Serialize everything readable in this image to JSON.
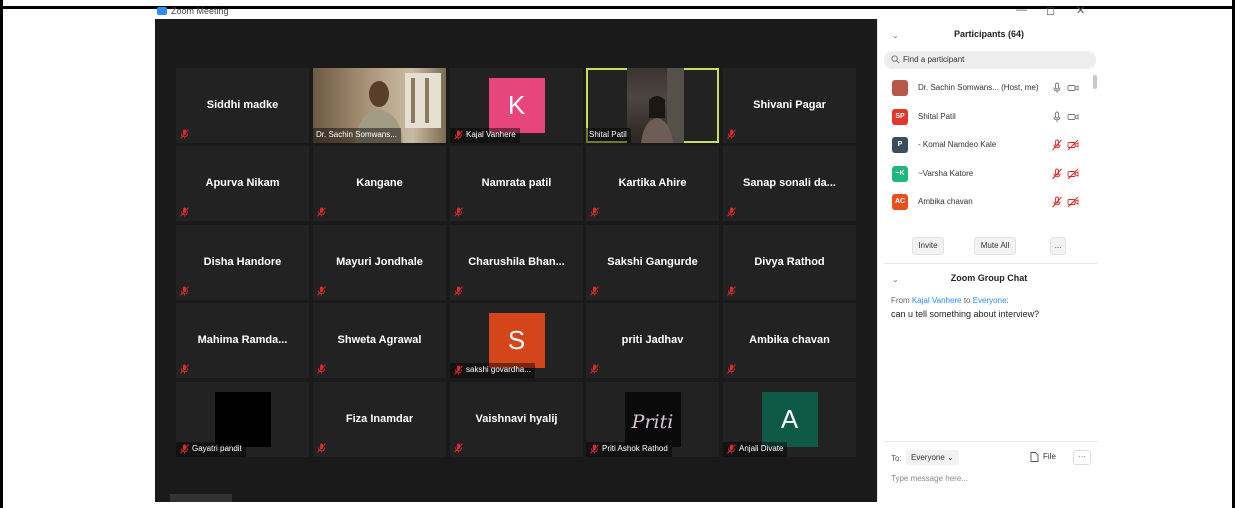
{
  "window": {
    "title": "Zoom Meeting",
    "minimize": "—",
    "maximize": "◻",
    "close": "✕"
  },
  "colors": {
    "stage": "#1a1a1a",
    "tile": "#222222",
    "active_border": "#c5e05a",
    "muted_mic": "#e02828"
  },
  "gallery": {
    "rows": [
      [
        {
          "name": "Siddhi madke",
          "type": "name"
        },
        {
          "name": "Dr. Sachin Somwans...",
          "type": "video"
        },
        {
          "name": "Kajal Vanhere",
          "type": "avatar",
          "letter": "K",
          "color": "#e8457c"
        },
        {
          "name": "Shital Patil",
          "type": "video",
          "active": true
        },
        {
          "name": "Shivani Pagar",
          "type": "name"
        }
      ],
      [
        {
          "name": "Apurva Nikam",
          "type": "name"
        },
        {
          "name": "Kangane",
          "type": "name"
        },
        {
          "name": "Namrata patil",
          "type": "name"
        },
        {
          "name": "Kartika Ahire",
          "type": "name"
        },
        {
          "name": "Sanap sonali da...",
          "type": "name"
        }
      ],
      [
        {
          "name": "Disha Handore",
          "type": "name"
        },
        {
          "name": "Mayuri Jondhale",
          "type": "name"
        },
        {
          "name": "Charushila  Bhan...",
          "type": "name"
        },
        {
          "name": "Sakshi Gangurde",
          "type": "name"
        },
        {
          "name": "Divya Rathod",
          "type": "name"
        }
      ],
      [
        {
          "name": "Mahima  Ramda...",
          "type": "name"
        },
        {
          "name": "Shweta Agrawal",
          "type": "name"
        },
        {
          "name": "sakshi govardha...",
          "type": "avatar",
          "letter": "S",
          "color": "#d4461a"
        },
        {
          "name": "priti Jadhav",
          "type": "name"
        },
        {
          "name": "Ambika chavan",
          "type": "name"
        }
      ],
      [
        {
          "name": "Gayatri pandit",
          "type": "photo-black"
        },
        {
          "name": "Fiza Inamdar",
          "type": "name"
        },
        {
          "name": "Vaishnavi hyalij",
          "type": "name"
        },
        {
          "name": "Priti Ashok Rathod",
          "type": "photo-priti",
          "photo_text": "Priti"
        },
        {
          "name": "Anjali Divate",
          "type": "avatar",
          "letter": "A",
          "color": "#0f5a47"
        }
      ]
    ]
  },
  "participants": {
    "header": "Participants (64)",
    "search_placeholder": "Find a participant",
    "list": [
      {
        "name": "Dr. Sachin Somwans...  (Host, me)",
        "initials": "",
        "color": "#b5574b",
        "muted": false,
        "video": true
      },
      {
        "name": "Shital Patil",
        "initials": "SP",
        "color": "#e0392b",
        "muted": false,
        "video": true
      },
      {
        "name": "- Komal Namdeo Kale",
        "initials": "P",
        "color": "#3a4d5c",
        "muted": true,
        "video": false
      },
      {
        "name": "~Varsha Katore",
        "initials": "~K",
        "color": "#1fb87a",
        "muted": true,
        "video": false
      },
      {
        "name": "Ambika chavan",
        "initials": "AC",
        "color": "#e8511c",
        "muted": true,
        "video": false
      }
    ],
    "buttons": {
      "invite": "Invite",
      "mute_all": "Mute All",
      "more": "..."
    }
  },
  "chat": {
    "header": "Zoom Group Chat",
    "from_prefix": "From",
    "from_name": "Kajal Vanhere",
    "to_word": "to",
    "to_name": "Everyone",
    "message": "can u tell something about interview?",
    "to_label": "To:",
    "recipient": "Everyone",
    "file_label": "File",
    "more": "···",
    "input_placeholder": "Type message here..."
  }
}
